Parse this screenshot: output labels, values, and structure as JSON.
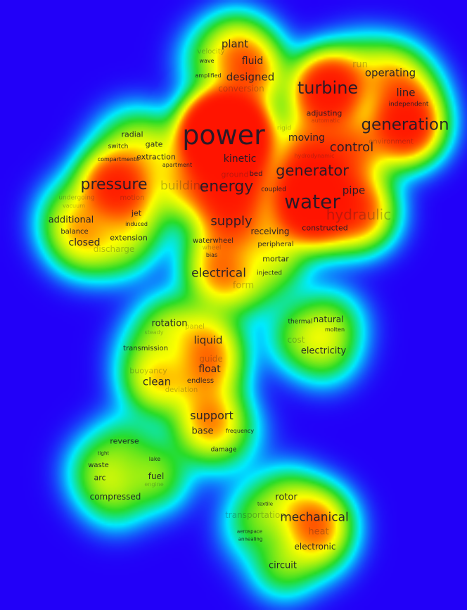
{
  "visualization": "density",
  "colors": {
    "low": "#2200f8",
    "mid_low": "#00f0ff",
    "mid": "#28dc28",
    "mid_high": "#ffff00",
    "high": "#ff0000",
    "label": "#1b1b2a"
  },
  "terms": [
    "plant",
    "velocity",
    "fluid",
    "wave",
    "designed",
    "amplified",
    "conversion",
    "turbine",
    "run",
    "operating",
    "line",
    "independent",
    "generation",
    "adjusting",
    "automatic",
    "rigid",
    "moving",
    "control",
    "environment",
    "hydrodynamic",
    "generator",
    "water",
    "pipe",
    "coupled",
    "hydraulic",
    "constructed",
    "power",
    "radial",
    "gate",
    "switch",
    "compartments",
    "extraction",
    "apartment",
    "kinetic",
    "bed",
    "ground",
    "pressure",
    "building",
    "energy",
    "undergoing",
    "motion",
    "vacuum",
    "jet",
    "induced",
    "additional",
    "balance",
    "closed",
    "extension",
    "discharge",
    "supply",
    "receiving",
    "waterwheel",
    "wheel",
    "bias",
    "peripheral",
    "mortar",
    "electrical",
    "injected",
    "form",
    "rotation",
    "panel",
    "steady",
    "liquid",
    "transmission",
    "guide",
    "float",
    "buoyancy",
    "clean",
    "endless",
    "deviation",
    "thermal",
    "natural",
    "molten",
    "cost",
    "electricity",
    "support",
    "base",
    "frequency",
    "damage",
    "reverse",
    "tight",
    "lake",
    "waste",
    "fuel",
    "arc",
    "engine",
    "compressed",
    "rotor",
    "textile",
    "transportation",
    "mechanical",
    "heat",
    "aerospace",
    "annealing",
    "electronic",
    "circuit"
  ]
}
